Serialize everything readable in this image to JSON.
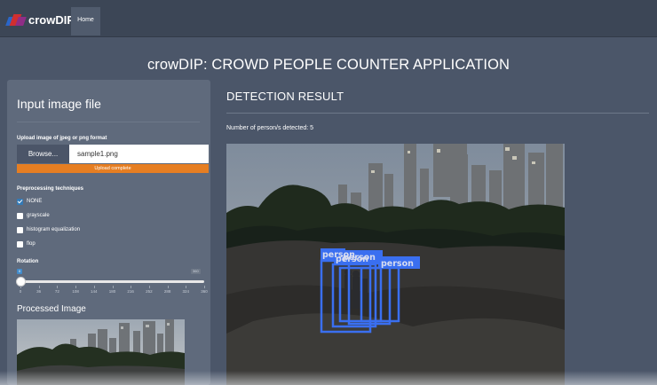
{
  "navbar": {
    "brand": "crowDIP",
    "home": "Home"
  },
  "app_title": "crowDIP: CROWD PEOPLE COUNTER APPLICATION",
  "sidebar": {
    "title": "Input image file",
    "upload_label": "Upload image of jpeg or png format",
    "browse_label": "Browse...",
    "file_name": "sample1.png",
    "upload_status": "Upload complete",
    "upload_progress": 1.0,
    "preprocessing_label": "Preprocessing techniques",
    "options": [
      {
        "label": "NONE",
        "checked": true
      },
      {
        "label": "grayscale",
        "checked": false
      },
      {
        "label": "histogram equalization",
        "checked": false
      },
      {
        "label": "flop",
        "checked": false
      }
    ],
    "rotation_label": "Rotation",
    "rotation": {
      "min": 0,
      "max": 360,
      "value": 0,
      "ticks": [
        "0",
        "36",
        "72",
        "108",
        "144",
        "180",
        "216",
        "252",
        "288",
        "324",
        "360"
      ]
    },
    "processed_title": "Processed Image"
  },
  "result": {
    "title": "DETECTION RESULT",
    "count_label": "Number of person/s detected:",
    "count_value": "5",
    "detections": [
      "person",
      "person",
      "person",
      "person",
      "person"
    ]
  },
  "colors": {
    "accent": "#e67e22",
    "box": "#3a6ff0",
    "sidebar": "#5f6a7c",
    "background": "#4b5669"
  },
  "icons": {
    "logo": "crowdip-logo-icon"
  }
}
